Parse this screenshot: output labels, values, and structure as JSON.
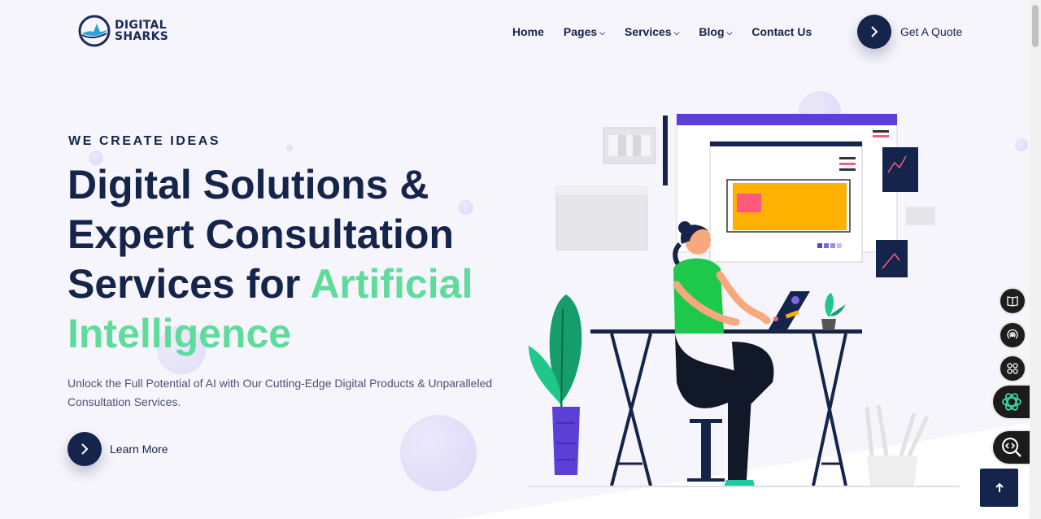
{
  "brand": {
    "line1": "DIGITAL",
    "line2": "SHARKS"
  },
  "nav": {
    "items": [
      {
        "label": "Home",
        "has_dropdown": false
      },
      {
        "label": "Pages",
        "has_dropdown": true
      },
      {
        "label": "Services",
        "has_dropdown": true
      },
      {
        "label": "Blog",
        "has_dropdown": true
      },
      {
        "label": "Contact Us",
        "has_dropdown": false
      }
    ],
    "cta_label": "Get A Quote"
  },
  "hero": {
    "eyebrow": "WE CREATE IDEAS",
    "headline_line1": "Digital Solutions &",
    "headline_line2": "Expert Consultation",
    "headline_line3_prefix": "Services for ",
    "headline_accent_1": "Artificial",
    "headline_accent_2": "Intelligence",
    "description": "Unlock the Full Potential of AI with Our Cutting-Edge Digital Products & Unparalleled Consultation Services.",
    "cta_label": "Learn More"
  },
  "side_toolbar": {
    "icons": [
      "book-icon",
      "signal-icon",
      "apps-grid-icon",
      "chatgpt-icon",
      "code-search-icon"
    ]
  },
  "colors": {
    "navy": "#15244a",
    "accent_green": "#5fdb9c",
    "background": "#f6f5fc",
    "orange": "#ffb000",
    "purple": "#5b3fd6"
  }
}
